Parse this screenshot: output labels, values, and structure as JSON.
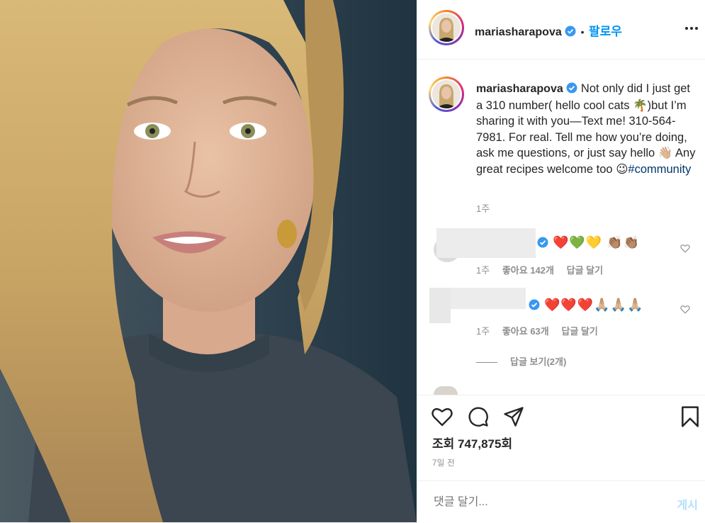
{
  "header": {
    "username": "mariasharapova",
    "separator": "•",
    "follow_label": "팔로우",
    "more_icon": "more-horizontal-icon"
  },
  "caption": {
    "username": "mariasharapova",
    "text_1": "Not only did I just get a 310 number( hello cool cats ",
    "text_2": ")but I’m sharing it with you—Text me! 310-564-7981. For real. Tell me how you’re doing, ask me questions, or just say hello ",
    "text_3": " Any great recipes welcome too ",
    "emoji_palm": "🌴",
    "emoji_wave": "👋🏼",
    "emoji_wink": "😉",
    "hashtag": "#community",
    "time": "1주"
  },
  "comments": [
    {
      "emojis": "❤️💚💛 👏🏽👏🏽",
      "time": "1주",
      "likes": "좋아요 142개",
      "reply": "답글 달기"
    },
    {
      "emojis": "❤️❤️❤️🙏🏼🙏🏼🙏🏼",
      "time": "1주",
      "likes": "좋아요 63개",
      "reply": "답글 달기"
    }
  ],
  "view_replies": "답글 보기(2개)",
  "actions": {
    "views_label": "조회 747,875회",
    "posted": "7일 전"
  },
  "comment_box": {
    "placeholder": "댓글 달기...",
    "post_label": "게시"
  },
  "colors": {
    "accent": "#0095f6",
    "verified": "#3897f0",
    "hashtag": "#00376b",
    "muted": "#8e8e8e"
  }
}
